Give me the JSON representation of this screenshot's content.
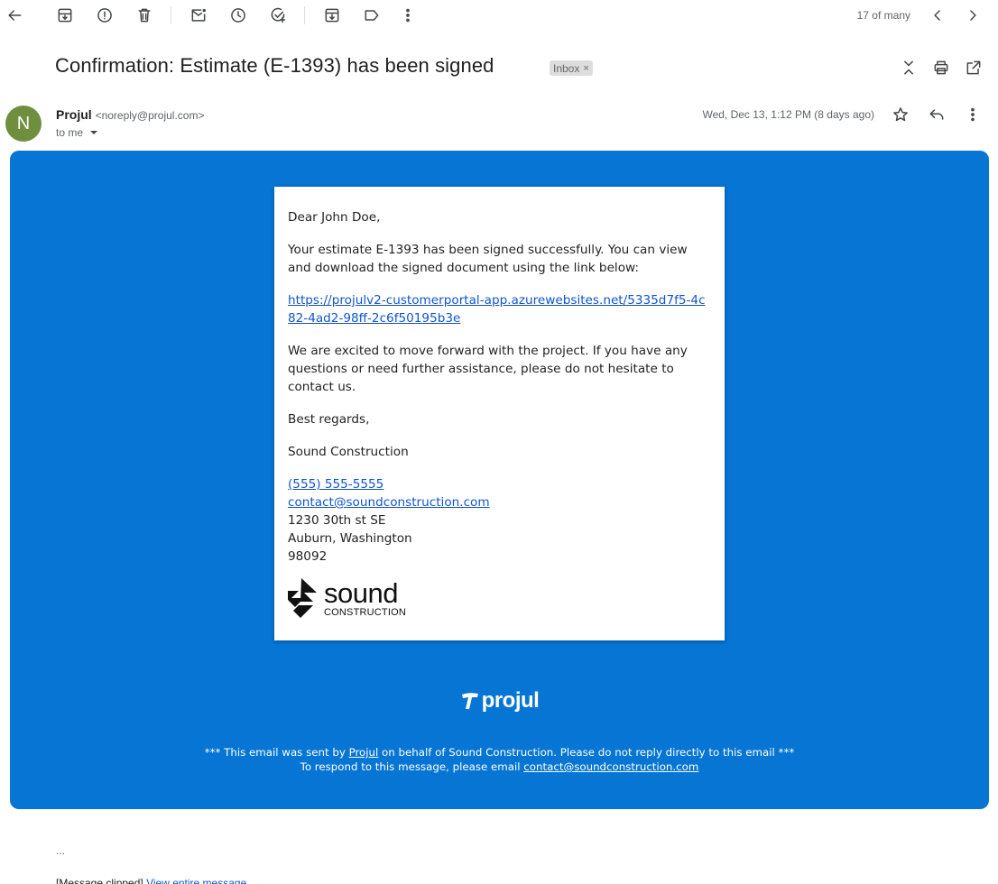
{
  "toolbar": {
    "counter": "17 of many"
  },
  "email": {
    "subject": "Confirmation: Estimate (E-1393) has been signed",
    "label_chip": "Inbox",
    "sender_name": "Projul",
    "sender_email": "<noreply@projul.com>",
    "recipient": "to me",
    "date": "Wed, Dec 13, 1:12 PM (8 days ago)",
    "avatar_letter": "N"
  },
  "body": {
    "greeting": "Dear John Doe,",
    "para1": "Your estimate E-1393 has been signed successfully. You can view and download the signed document using the link below:",
    "link": "https://projulv2-customerportal-app.azurewebsites.net/5335d7f5-4c82-4ad2-98ff-2c6f50195b3e",
    "para2": "We are excited to move forward with the project. If you have any questions or need further assistance, please do not hesitate to contact us.",
    "regards": "Best regards,",
    "company": "Sound Construction",
    "phone": "(555) 555-5555",
    "contact_email": "contact@soundconstruction.com",
    "address1": "1230 30th st SE",
    "address2": "Auburn, Washington",
    "zip": "98092",
    "logo_word": "sound",
    "logo_sub": "CONSTRUCTION"
  },
  "footer": {
    "brand": "projul",
    "line1_pre": "*** This email was sent by ",
    "line1_link": "Projul",
    "line1_post": " on behalf of Sound Construction. Please do not reply directly to this email ***",
    "line2_pre": "To respond to this message, please email ",
    "line2_link": "contact@soundconstruction.com"
  },
  "trailing": {
    "ellipsis": "...",
    "clipped_pre": "[Message clipped]",
    "clipped_link": "View entire message"
  },
  "colors": {
    "banner": "#0675d3",
    "avatar": "#6f8f3f",
    "link": "#1155cc"
  }
}
